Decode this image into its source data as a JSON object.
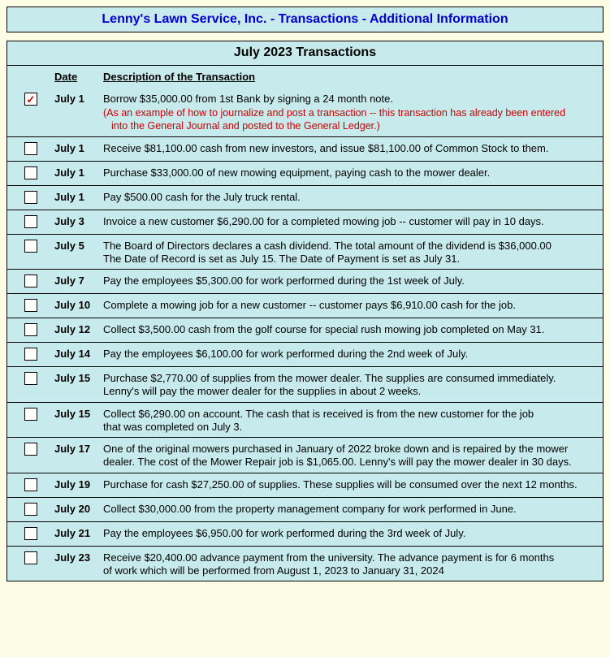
{
  "title": "Lenny's Lawn Service, Inc.  -  Transactions  -  Additional Information",
  "section_title": "July 2023 Transactions",
  "headers": {
    "date": "Date",
    "desc": "Description of the Transaction"
  },
  "rows": [
    {
      "checked": true,
      "date": "July 1",
      "desc": "Borrow $35,000.00 from 1st Bank by signing a 24 month note.",
      "red1": "(As an example of how to journalize and post a transaction -- this transaction has already been entered",
      "red2": "into the General Journal and posted to the General Ledger.)"
    },
    {
      "checked": false,
      "date": "July 1",
      "desc": "Receive $81,100.00 cash from new investors, and issue $81,100.00 of Common Stock to them."
    },
    {
      "checked": false,
      "date": "July 1",
      "desc": "Purchase $33,000.00 of new mowing equipment, paying cash to the mower dealer."
    },
    {
      "checked": false,
      "date": "July 1",
      "desc": "Pay $500.00 cash for the July truck rental."
    },
    {
      "checked": false,
      "date": "July 3",
      "desc": "Invoice a new customer $6,290.00 for a completed mowing job -- customer will pay in 10 days."
    },
    {
      "checked": false,
      "date": "July 5",
      "desc": "The Board of Directors declares a cash dividend.  The total amount of the dividend is $36,000.00\nThe Date of Record is set as July 15.  The Date of Payment is set as July 31."
    },
    {
      "checked": false,
      "date": "July 7",
      "desc": "Pay the employees $5,300.00 for work performed during the 1st week of July."
    },
    {
      "checked": false,
      "date": "July 10",
      "desc": "Complete a mowing job for a new customer -- customer pays $6,910.00 cash for the job."
    },
    {
      "checked": false,
      "date": "July 12",
      "desc": "Collect $3,500.00 cash from the golf course for special rush mowing job completed on May 31."
    },
    {
      "checked": false,
      "date": "July 14",
      "desc": "Pay the employees $6,100.00 for work performed during the 2nd week of July."
    },
    {
      "checked": false,
      "date": "July 15",
      "desc": "Purchase $2,770.00 of supplies from the mower dealer.  The supplies are consumed immediately.\nLenny's will pay the mower dealer for the supplies in about 2 weeks."
    },
    {
      "checked": false,
      "date": "July 15",
      "desc": "Collect $6,290.00 on account.  The cash that is received is from the new customer for the job\nthat was completed on July 3."
    },
    {
      "checked": false,
      "date": "July 17",
      "desc": "One of the original mowers purchased in January of 2022 broke down and is repaired by the mower\ndealer.  The cost of the Mower Repair job is $1,065.00.  Lenny's will pay the mower dealer in 30 days."
    },
    {
      "checked": false,
      "date": "July 19",
      "desc": "Purchase for cash $27,250.00 of supplies.  These supplies will be consumed over the next 12 months."
    },
    {
      "checked": false,
      "date": "July 20",
      "desc": "Collect $30,000.00 from the property management company for work performed in June."
    },
    {
      "checked": false,
      "date": "July 21",
      "desc": "Pay the employees $6,950.00 for work performed during the 3rd week of July."
    },
    {
      "checked": false,
      "date": "July 23",
      "desc": "Receive $20,400.00 advance payment from the university.  The advance payment is for 6 months\nof work which will be performed from August 1, 2023 to January 31, 2024"
    }
  ]
}
